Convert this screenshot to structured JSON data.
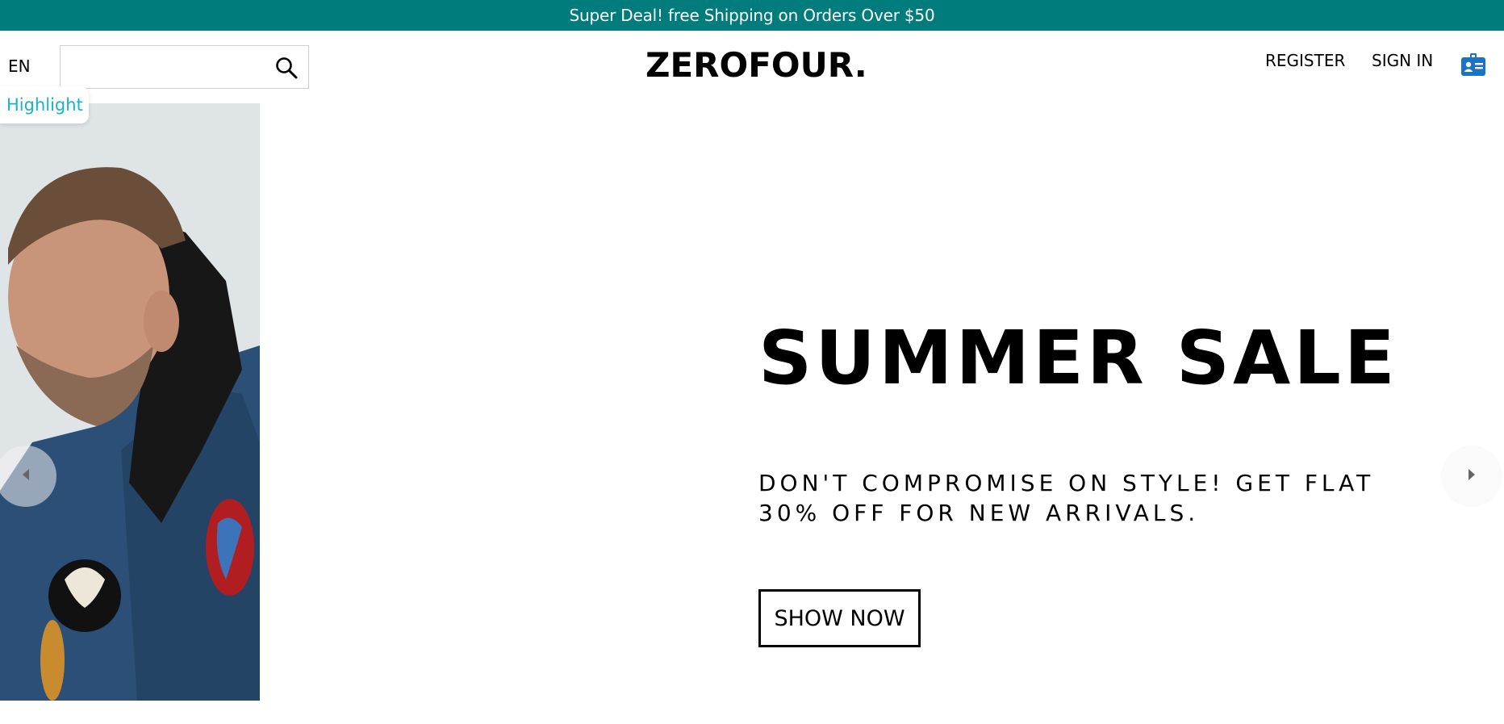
{
  "announcement": {
    "text": "Super Deal! free Shipping on Orders Over $50"
  },
  "header": {
    "language": "EN",
    "search": {
      "value": "",
      "placeholder": ""
    },
    "logo": "ZEROFOUR.",
    "register_label": "REGISTER",
    "signin_label": "SIGN IN"
  },
  "highlight_label": "Highlight",
  "hero": {
    "title": "SUMMER SALE",
    "subtitle": "DON'T COMPROMISE ON STYLE! GET FLAT 30% OFF FOR NEW ARRIVALS.",
    "cta_label": "SHOW NOW"
  },
  "colors": {
    "announcement_bg": "#007c7c",
    "highlight_text": "#17b3c6",
    "card_icon": "#1a73c9"
  },
  "icons": {
    "search": "search-icon",
    "account": "id-card-icon",
    "prev": "chevron-left-icon",
    "next": "chevron-right-icon"
  }
}
